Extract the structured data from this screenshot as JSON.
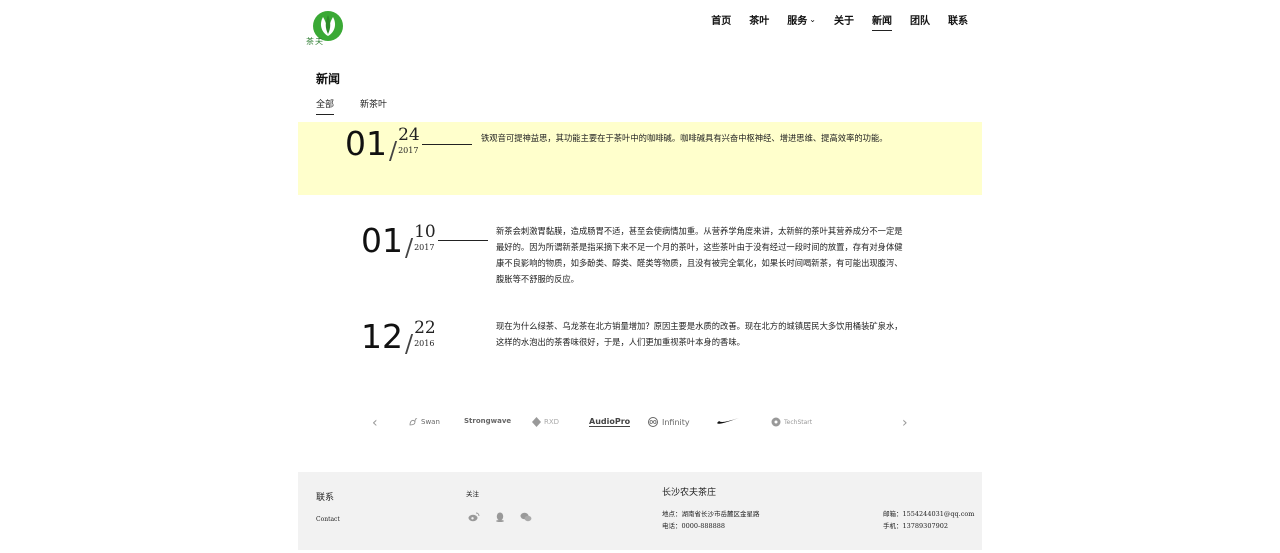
{
  "header": {
    "logo_text": "茶夫",
    "nav": [
      {
        "label": "首页"
      },
      {
        "label": "茶叶"
      },
      {
        "label": "服务"
      },
      {
        "label": "关于"
      },
      {
        "label": "新闻"
      },
      {
        "label": "团队"
      },
      {
        "label": "联系"
      }
    ],
    "active_nav": "新闻"
  },
  "page": {
    "title": "新闻",
    "tabs": [
      {
        "label": "全部"
      },
      {
        "label": "新茶叶"
      }
    ]
  },
  "news": [
    {
      "month": "01",
      "slash": "/",
      "day": "24",
      "year": "2017",
      "summary": "铁观音可提神益思，其功能主要在于茶叶中的咖啡碱。咖啡碱具有兴奋中枢神经、增进思维、提高效率的功能。",
      "highlighted": true
    },
    {
      "month": "01",
      "slash": "/",
      "day": "10",
      "year": "2017",
      "summary": "新茶会刺激胃黏膜，造成肠胃不适，甚至会使病情加重。从营养学角度来讲，太新鲜的茶叶其营养成分不一定是最好的。因为所谓新茶是指采摘下来不足一个月的茶叶，这些茶叶由于没有经过一段时间的放置，存有对身体健康不良影响的物质，如多酚类、醇类、醛类等物质，且没有被完全氧化，如果长时间喝新茶，有可能出现腹泻、腹胀等不舒服的反应。",
      "highlighted": false
    },
    {
      "month": "12",
      "slash": "/",
      "day": "22",
      "year": "2016",
      "summary": "现在为什么绿茶、乌龙茶在北方销量增加？原因主要是水质的改善。现在北方的城镇居民大多饮用桶装矿泉水，这样的水泡出的茶香味很好，于是，人们更加重视茶叶本身的香味。",
      "highlighted": false
    }
  ],
  "partners": {
    "prev": "‹",
    "next": "›",
    "logos": [
      {
        "name": "Swan"
      },
      {
        "name": "Strongwave"
      },
      {
        "name": "RXD"
      },
      {
        "name": "AudioPro"
      },
      {
        "name": "Infinity"
      },
      {
        "name": "",
        "icon": "nike-swoosh-icon"
      },
      {
        "name": "TechStart"
      }
    ]
  },
  "footer": {
    "contact_title": "联系",
    "contact_en": "Contact",
    "follow_title": "关注",
    "social_icons": [
      "weibo-icon",
      "qq-icon",
      "wechat-icon"
    ],
    "company": "长沙农夫茶庄",
    "address": "地点：湖南省长沙市岳麓区金星路",
    "phone": "电话：0000-888888",
    "email": "邮箱：1554244031@qq.com",
    "mobile": "手机：13789307902"
  },
  "colors": {
    "highlight_bg": "#ffffcc",
    "footer_bg": "#f2f2f2",
    "logo_green": "#3aa935"
  }
}
